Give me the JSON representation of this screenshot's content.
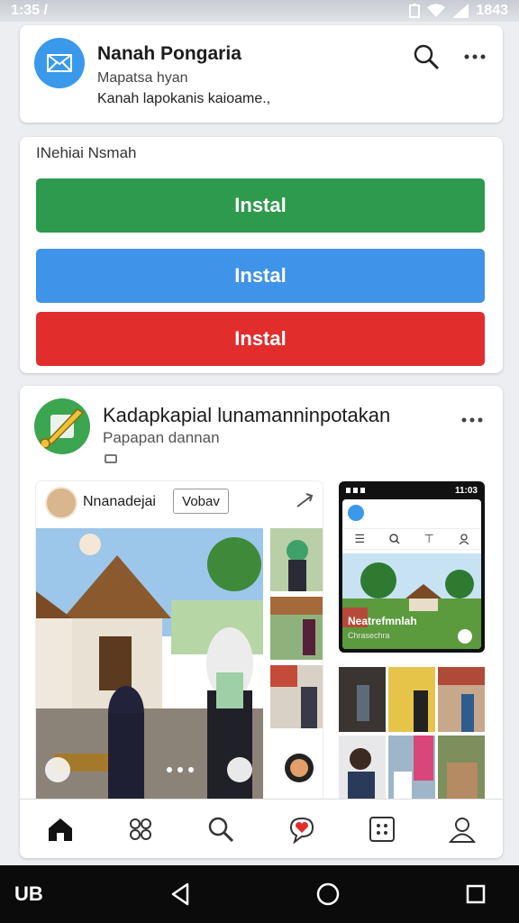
{
  "status_bar": {
    "time": "1:35 /",
    "right": "1843"
  },
  "header": {
    "title": "Nanah Pongaria",
    "subtitle": "Mapatsa hyan",
    "description": "Kanah lapokanis kaioame.,"
  },
  "install_card": {
    "label": "INehiai Nsmah",
    "buttons": [
      {
        "label": "Instal",
        "color": "#2e9a4e"
      },
      {
        "label": "Instal",
        "color": "#3f93e9"
      },
      {
        "label": "Instal",
        "color": "#e22d2d"
      }
    ]
  },
  "post": {
    "title": "Kadapkapial lunamanninpotakan",
    "subtitle": "Papapan dannan",
    "inner_profile_name": "Nnanadejai",
    "inner_button": "Vobav",
    "phone_status_time": "11:03",
    "phone_caption": "Neatrefmnlah",
    "phone_caption_sub": "Chrasechra"
  },
  "nav_bar": {
    "label": "UB"
  },
  "colors": {
    "accent_blue": "#3a99ea",
    "background": "#eceef1"
  }
}
